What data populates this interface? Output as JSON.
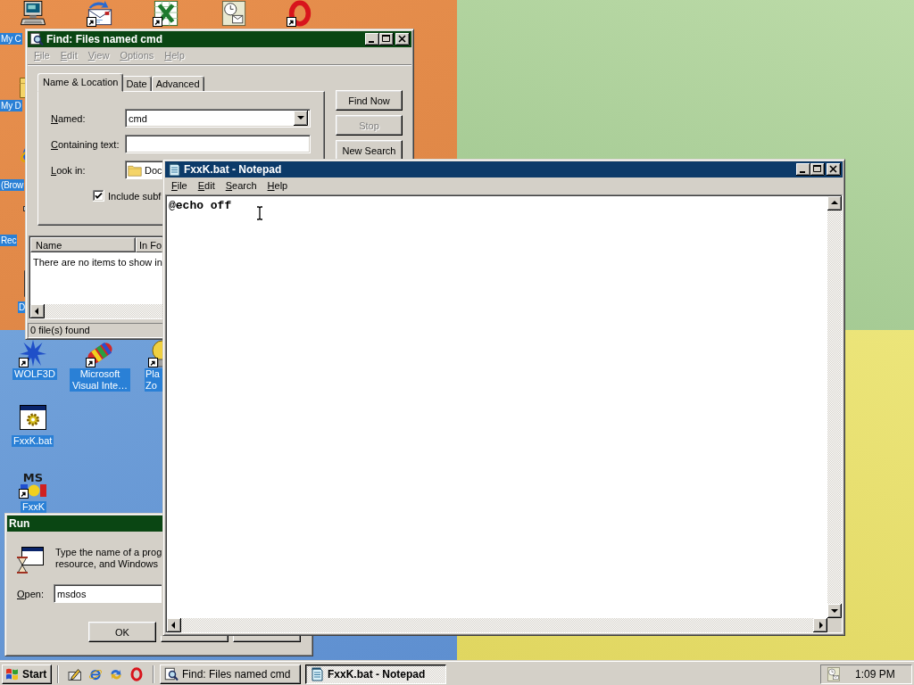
{
  "desktop": {
    "icons": [
      {
        "label": "My C",
        "shortcut": false
      },
      {
        "shortcut": true
      },
      {
        "shortcut": true
      },
      {
        "shortcut": false
      },
      {
        "shortcut": true
      },
      {
        "label": "My D",
        "shortcut": false
      },
      {
        "label": "(Brow",
        "shortcut": false
      },
      {
        "label": "Rec",
        "shortcut": false
      },
      {
        "label": "D",
        "shortcut": false
      },
      {
        "label": "WOLF3D",
        "shortcut": true
      },
      {
        "label": "Microsoft Visual Inte…",
        "shortcut": true
      },
      {
        "label": "Pla Zo",
        "shortcut": true
      },
      {
        "label": "FxxK.bat",
        "shortcut": false
      },
      {
        "label": "FxxK",
        "shortcut": true,
        "logo_text": "MS"
      }
    ]
  },
  "find_window": {
    "title": "Find: Files named cmd",
    "active": false,
    "menu": [
      {
        "label": "File",
        "disabled": true
      },
      {
        "label": "Edit",
        "disabled": true
      },
      {
        "label": "View",
        "disabled": true
      },
      {
        "label": "Options",
        "disabled": true
      },
      {
        "label": "Help",
        "disabled": true
      }
    ],
    "tabs": [
      {
        "label": "Name & Location",
        "selected": true
      },
      {
        "label": "Date",
        "selected": false
      },
      {
        "label": "Advanced",
        "selected": false
      }
    ],
    "fields": [
      {
        "kind": "combo",
        "label": "Named:",
        "value": "cmd"
      },
      {
        "kind": "text",
        "label": "Containing text:"
      },
      {
        "kind": "folder",
        "label": "Look in:",
        "value": "Doc"
      }
    ],
    "include_subfolders": {
      "label": "Include subf",
      "checked": true
    },
    "buttons": [
      {
        "label": "Find Now",
        "disabled": false
      },
      {
        "label": "Stop",
        "disabled": true
      },
      {
        "label": "New Search",
        "disabled": false
      }
    ],
    "results": {
      "columns": [
        "Name",
        "In Fo"
      ],
      "message": "There are no items to show in"
    },
    "status_bar": "0 file(s) found"
  },
  "notepad": {
    "title": "FxxK.bat - Notepad",
    "active": true,
    "menu": [
      {
        "label": "File",
        "disabled": false
      },
      {
        "label": "Edit",
        "disabled": false
      },
      {
        "label": "Search",
        "disabled": false
      },
      {
        "label": "Help",
        "disabled": false
      }
    ],
    "text": "@echo off"
  },
  "run_dialog": {
    "title": "Run",
    "active": false,
    "prompt": [
      "Type the name of a prog",
      "resource, and Windows"
    ],
    "open_label": "Open:",
    "value": "msdos",
    "buttons": [
      {
        "kind": "labeled",
        "label": "OK"
      },
      {
        "kind": "covered"
      },
      {
        "kind": "covered"
      }
    ]
  },
  "taskbar": {
    "start": "Start",
    "tasks": [
      {
        "label": "Find: Files named cmd",
        "selected": false
      },
      {
        "label": "FxxK.bat - Notepad",
        "selected": true
      }
    ],
    "clock": "1:09 PM"
  }
}
